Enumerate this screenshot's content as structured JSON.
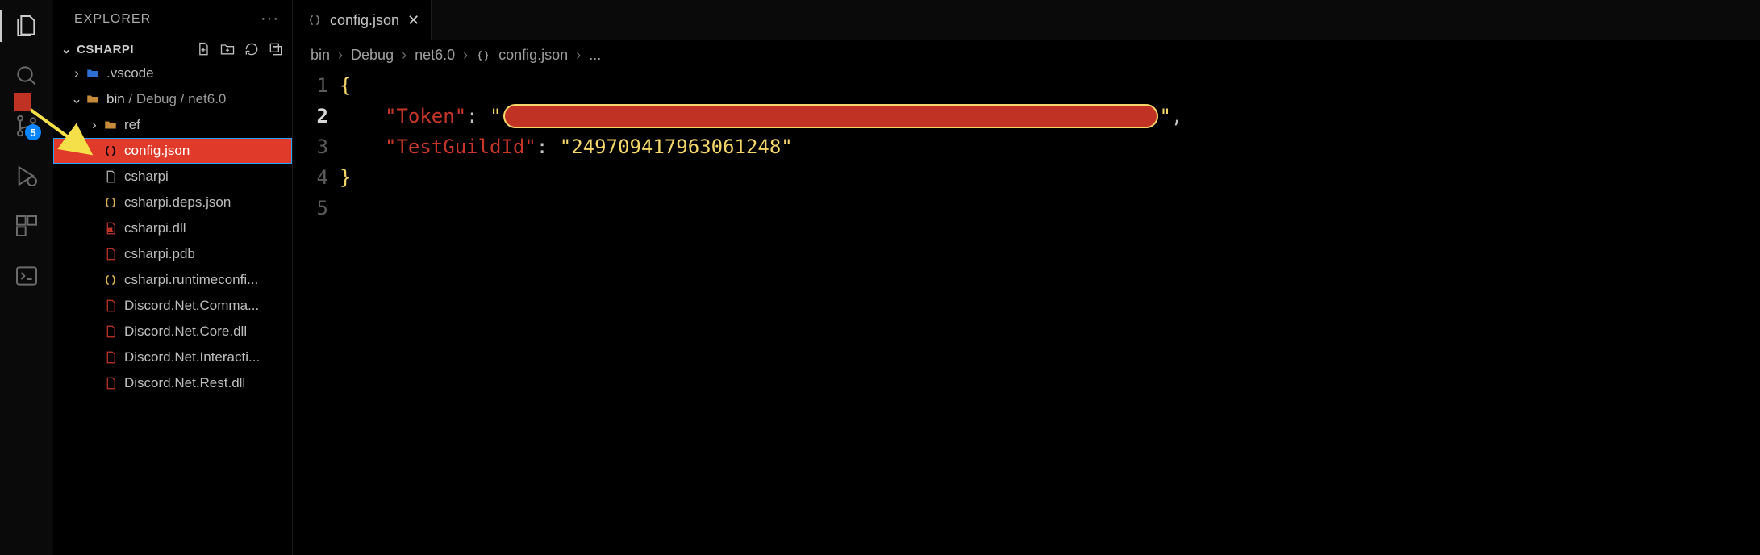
{
  "activity": {
    "badge_scm": "5"
  },
  "sidebar": {
    "title": "EXPLORER",
    "project": "CSHARPI",
    "tree": {
      "vscode": ".vscode",
      "binpath_first": "bin",
      "binpath_rest": " / Debug / net6.0",
      "ref": "ref",
      "config": "config.json",
      "csharpi": "csharpi",
      "deps": "csharpi.deps.json",
      "dll": "csharpi.dll",
      "pdb": "csharpi.pdb",
      "runtime": "csharpi.runtimeconfi...",
      "dcomm": "Discord.Net.Comma...",
      "dcore": "Discord.Net.Core.dll",
      "dinter": "Discord.Net.Interacti...",
      "drest": "Discord.Net.Rest.dll"
    }
  },
  "tab": {
    "label": "config.json"
  },
  "breadcrumb": {
    "a": "bin",
    "b": "Debug",
    "c": "net6.0",
    "d": "config.json",
    "e": "..."
  },
  "code": {
    "ln1": "1",
    "ln2": "2",
    "ln3": "3",
    "ln4": "4",
    "ln5": "5",
    "open_brace": "{",
    "close_brace": "}",
    "key_token": "\"Token\"",
    "colon": ":",
    "quote": "\"",
    "comma": ",",
    "key_guild": "\"TestGuildId\"",
    "val_guild": "\"249709417963061248\""
  }
}
